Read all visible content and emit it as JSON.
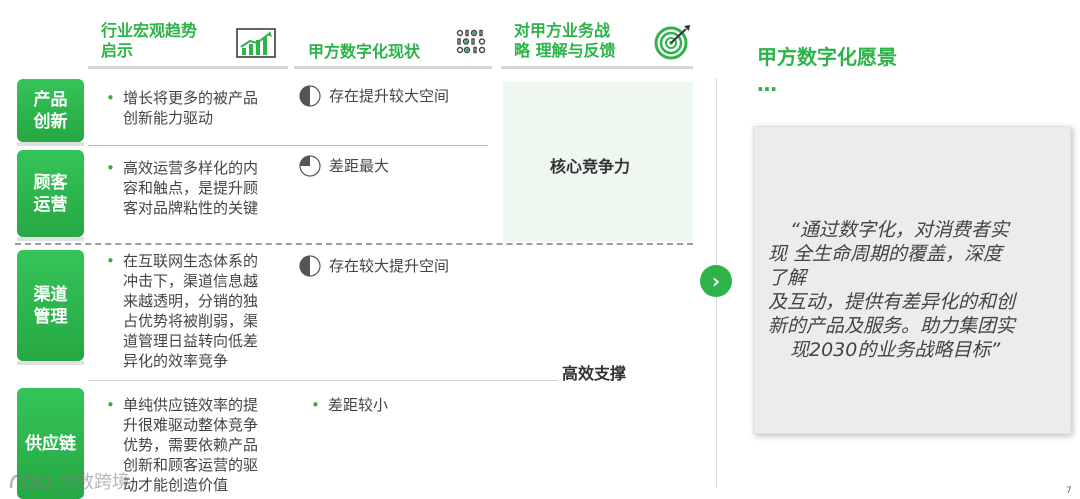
{
  "headers": {
    "col1": [
      "行业宏观趋势",
      "启示"
    ],
    "col2": "甲方数字化现状",
    "col3": [
      "对甲方业务战",
      "略 理解与反馈"
    ],
    "vision_title": "甲方数字化愿景",
    "vision_dots": "…"
  },
  "rows": [
    {
      "tab": [
        "产品",
        "创新"
      ],
      "insight": [
        "增长将更多的被产品",
        "创新能力驱动"
      ],
      "status": "存在提升较大空间",
      "pie_fill": 0.5
    },
    {
      "tab": [
        "顾客",
        "运营"
      ],
      "insight": [
        "高效运营多样化的内",
        "容和触点，是提升顾",
        "客对品牌粘性的关键"
      ],
      "status": "差距最大",
      "pie_fill": 0.25
    },
    {
      "tab": [
        "渠道",
        "管理"
      ],
      "insight": [
        "在互联网生态体系的",
        "冲击下，渠道信息越",
        "来越透明，分销的独",
        "占优势将被削弱，渠",
        "道管理日益转向低差",
        "异化的效率竞争"
      ],
      "status": "存在较大提升空间",
      "pie_fill": 0.5
    },
    {
      "tab": [
        "供应链"
      ],
      "insight": [
        "单纯供应链效率的提",
        "升很难驱动整体竞争",
        "优势，需要依赖产品",
        "创新和顾客运营的驱",
        "动才能创造价值"
      ],
      "status": "差距较小",
      "pie_fill": 0
    }
  ],
  "feedback": {
    "core": "核心竞争力",
    "support": "高效支撑"
  },
  "vision_quote": [
    "“通过数字化，对消费者实",
    "现 全生命周期的覆盖，深度",
    "了解",
    "及互动，提供有差异化的和创",
    "新的产品及服务。助力集团实",
    "现2030的业务战略目标”"
  ],
  "watermark": "大数跨境",
  "page_number": "7",
  "colors": {
    "accent": "#2db34a",
    "panel": "#eef8f1",
    "card": "#ececec"
  }
}
